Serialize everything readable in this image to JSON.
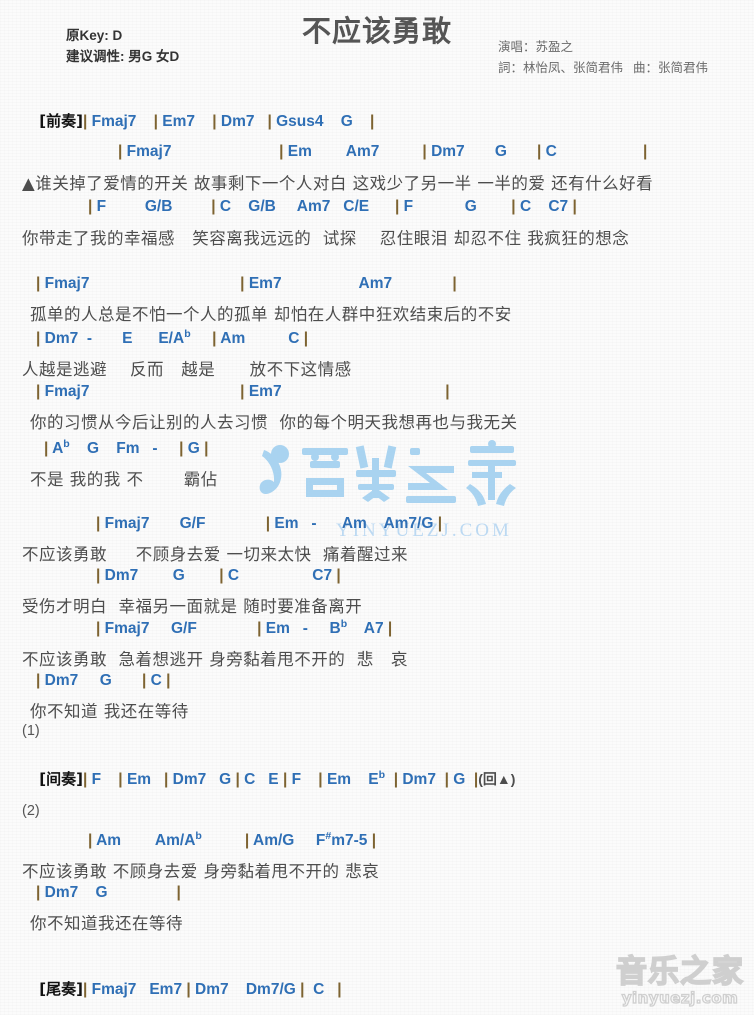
{
  "header": {
    "title": "不应该勇敢",
    "original_key_label": "原Key:",
    "original_key": "D",
    "suggested_key_label": "建议调性:",
    "suggested_key_male": "男G",
    "suggested_key_female": "女D",
    "singer_label": "演唱：",
    "singer": "苏盈之",
    "lyricist_label": "詞：",
    "lyricist": "林怡凤、张简君伟",
    "composer_label": "曲：",
    "composer": "张简君伟"
  },
  "watermark": {
    "center_text": "YINYUEZJ.COM",
    "corner_cn": "音乐之家",
    "corner_url": "yinyuezj.com",
    "color": "#bcd9f2"
  },
  "colors": {
    "chord": "#2f6fb5",
    "lyric": "#4d4d4d",
    "bar": "#7d6331",
    "title": "#555555"
  },
  "sections": {
    "intro_tag": "[前奏]",
    "interlude_tag": "[间奏]",
    "outro_tag": "[尾奏]",
    "repeat_1": "(1)",
    "repeat_2": "(2)",
    "return_marker": "(回▲)"
  },
  "lines": {
    "intro_chords": "| Fmaj7    | Em7    | Dm7   | Gsus4    G    |",
    "v1_chord_1": "| Fmaj7                         | Em        Am7          | Dm7       G       | C                    |",
    "v1_lyric_1": "▲谁关掉了爱情的开关 故事剩下一个人对白 这戏少了另一半 一半的爱 还有什么好看",
    "v1_chord_2": "| F         G/B         | C    G/B     Am7   C/E      | F            G        | C    C7 |",
    "v1_lyric_2": "你带走了我的幸福感   笑容离我远远的  试探    忍住眼泪 却忍不住 我疯狂的想念",
    "v2_chord_1": "| Fmaj7                                   | Em7                  Am7              |",
    "v2_lyric_1": "孤单的人总是不怕一个人的孤单 却怕在人群中狂欢结束后的不安",
    "v2_chord_2": "| Dm7  -       E      E/A♭     | Am          C |",
    "v2_lyric_2": "人越是逃避    反而   越是      放不下这情感",
    "v3_chord_1": "| Fmaj7                                   | Em7                                      |",
    "v3_lyric_1": "你的习惯从今后让别的人去习惯  你的每个明天我想再也与我无关",
    "v3_chord_2": "| A♭    G    Fm   -     | G |",
    "v3_lyric_2": "不是 我的我 不       霸佔",
    "ch1_chord_1": "| Fmaj7       G/F              | Em   -      Am    Am7/G |",
    "ch1_lyric_1": "不应该勇敢     不顾身去爱 一切来太快  痛着醒过来",
    "ch1_chord_2": "| Dm7        G        | C                 C7 |",
    "ch1_lyric_2": "受伤才明白  幸福另一面就是 随时要准备离开",
    "ch2_chord_1": "| Fmaj7     G/F              | Em   -     B♭    A7 |",
    "ch2_lyric_1": "不应该勇敢  急着想逃开 身旁黏着甩不开的  悲   哀",
    "ch2_chord_2": "| Dm7     G       | C |",
    "ch2_lyric_2": "你不知道 我还在等待",
    "interlude_chords": "| F    | Em   | Dm7   G | C   E | F    | Em    E♭  | Dm7  | G  |",
    "final_chord_1": "| Am        Am/A♭          | Am/G     F♯m7-5 |",
    "final_lyric_1": "不应该勇敢 不顾身去爱 身旁黏着甩不开的 悲哀",
    "final_chord_2": "| Dm7    G                |",
    "final_lyric_2": "你不知道我还在等待",
    "outro_chords": "| Fmaj7   Em7 | Dm7    Dm7/G |  C   |"
  },
  "chords_used": [
    "Fmaj7",
    "Em7",
    "Dm7",
    "Gsus4",
    "G",
    "Em",
    "Am7",
    "C",
    "F",
    "G/B",
    "C/E",
    "C7",
    "E",
    "E/Ab",
    "Am",
    "Ab",
    "Fm",
    "G/F",
    "Am7/G",
    "Bb",
    "A7",
    "Eb",
    "Am/Ab",
    "Am/G",
    "F#m7-5",
    "Dm7/G"
  ]
}
